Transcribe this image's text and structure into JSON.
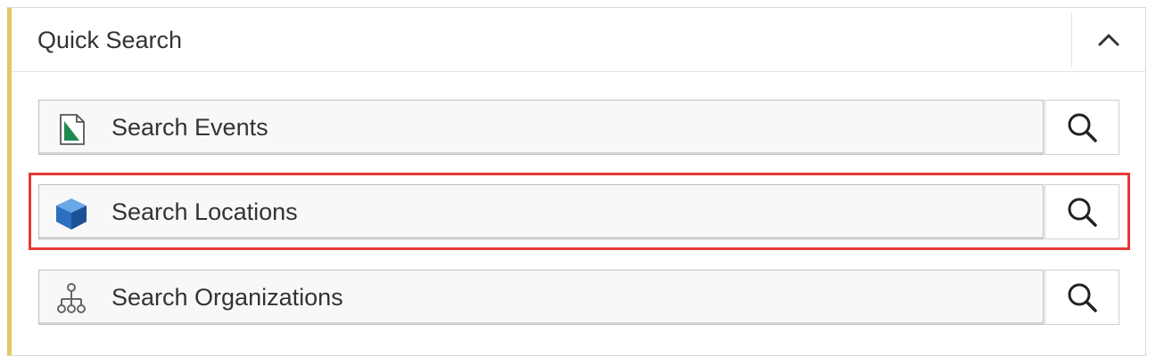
{
  "panel": {
    "title": "Quick Search",
    "collapse_icon": "chevron-up-icon",
    "accent_color": "#e8c56a"
  },
  "searches": [
    {
      "label": "Search Events",
      "icon": "event-document-icon",
      "button_icon": "search-icon"
    },
    {
      "label": "Search Locations",
      "icon": "location-cube-icon",
      "button_icon": "search-icon",
      "highlighted": true
    },
    {
      "label": "Search Organizations",
      "icon": "organization-hierarchy-icon",
      "button_icon": "search-icon"
    }
  ],
  "highlight_color": "#e53935"
}
